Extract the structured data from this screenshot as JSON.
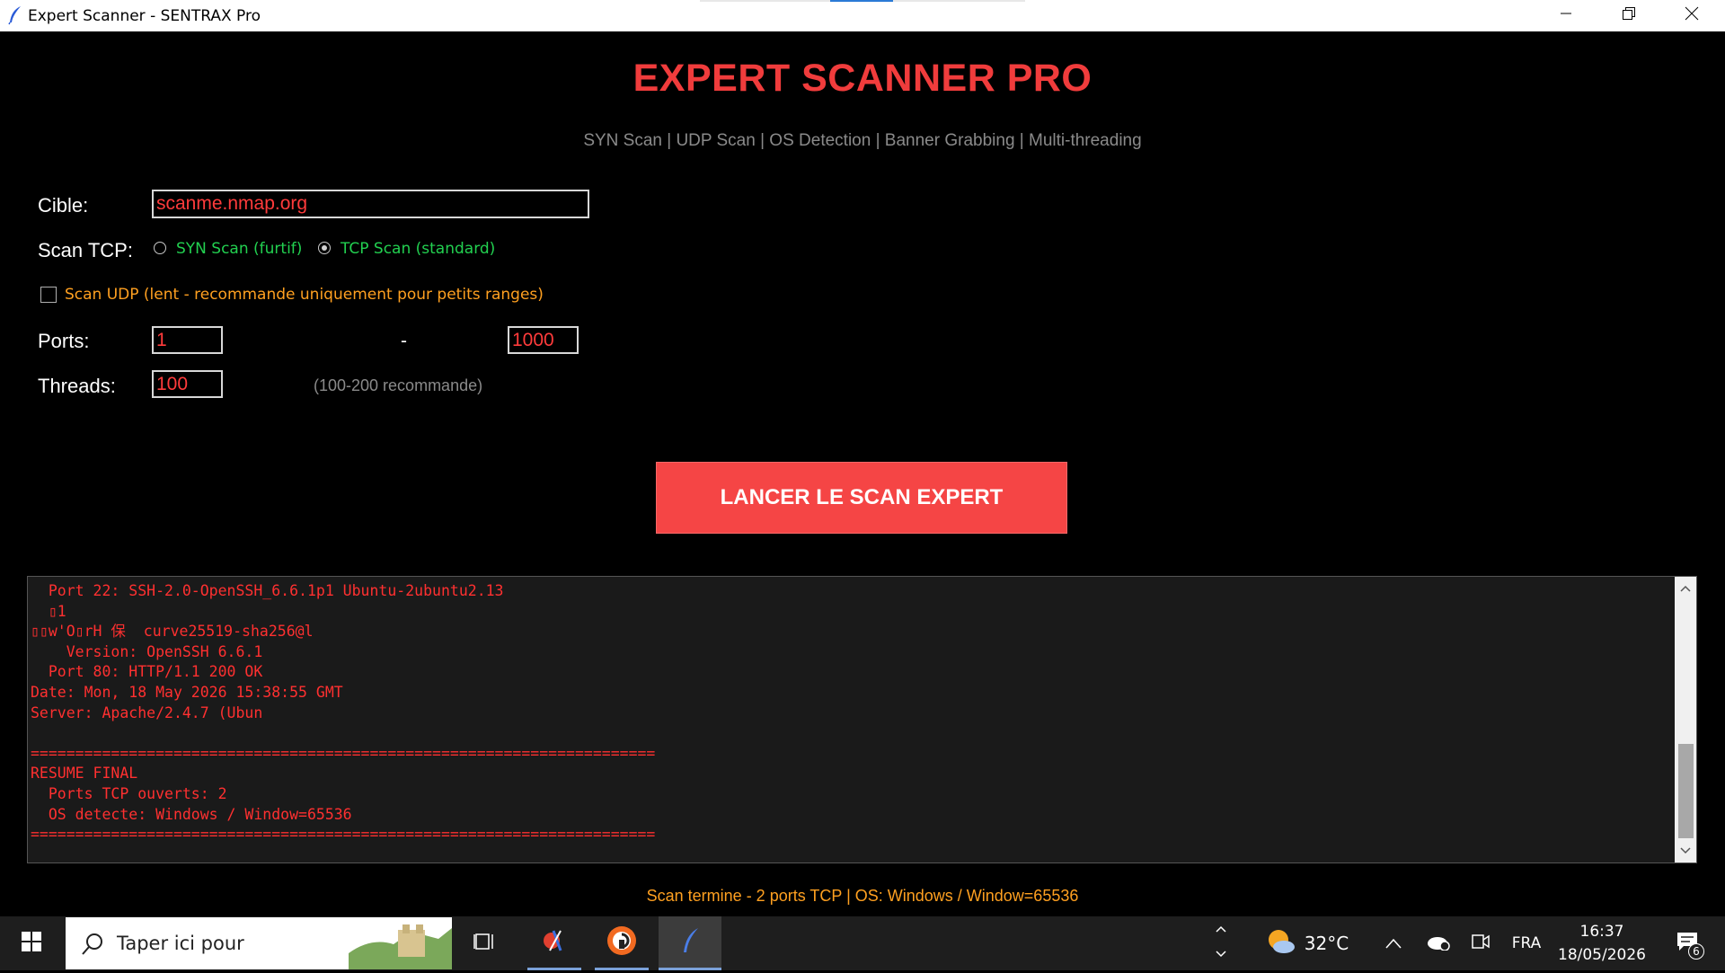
{
  "window": {
    "title": "Expert Scanner - SENTRAX Pro",
    "icons": {
      "app": "feather-icon",
      "minimize": "minimize-icon",
      "restore": "restore-icon",
      "close": "close-icon"
    }
  },
  "header": {
    "title": "EXPERT SCANNER PRO",
    "subtitle": "SYN Scan | UDP Scan | OS Detection | Banner Grabbing | Multi-threading"
  },
  "form": {
    "target_label": "Cible:",
    "target_value": "scanme.nmap.org",
    "scan_tcp_label": "Scan TCP:",
    "syn_option": "SYN Scan (furtif)",
    "tcp_option": "TCP Scan (standard)",
    "selected_tcp_mode": "TCP Scan (standard)",
    "udp_label": "Scan UDP (lent - recommande uniquement pour petits ranges)",
    "udp_checked": false,
    "ports_label": "Ports:",
    "port_start": "1",
    "port_separator": "-",
    "port_end": "1000",
    "threads_label": "Threads:",
    "threads_value": "100",
    "threads_hint": "(100-200 recommande)"
  },
  "scan_button": {
    "label": "LANCER LE SCAN EXPERT"
  },
  "console": {
    "lines": [
      "  Port 22: SSH-2.0-OpenSSH_6.6.1p1 Ubuntu-2ubuntu2.13",
      "  ▯1",
      "▯▯w'O▯rH 保  curve25519-sha256@l",
      "    Version: OpenSSH 6.6.1",
      "  Port 80: HTTP/1.1 200 OK",
      "Date: Mon, 18 May 2026 15:38:55 GMT",
      "Server: Apache/2.4.7 (Ubun",
      "",
      "======================================================================",
      "RESUME FINAL",
      "  Ports TCP ouverts: 2",
      "  OS detecte: Windows / Window=65536",
      "======================================================================"
    ]
  },
  "status": {
    "text": "Scan termine - 2 ports TCP | OS: Windows / Window=65536"
  },
  "taskbar": {
    "search_placeholder": "Taper ici pour",
    "weather_temp": "32°C",
    "language": "FRA",
    "time": "16:37",
    "date": "18/05/2026",
    "notification_count": "6",
    "icons": [
      "windows-start-icon",
      "search-icon",
      "task-view-icon",
      "app-snipping-icon",
      "app-circle-icon",
      "feather-icon",
      "weather-icon",
      "chevron-up-icon",
      "onedrive-icon",
      "meet-icon",
      "notification-icon"
    ]
  },
  "colors": {
    "accent_red": "#f03c3c",
    "button_red": "#f54545",
    "option_green": "#22d050",
    "warning_orange": "#ffa020",
    "console_text": "#ff3030"
  }
}
